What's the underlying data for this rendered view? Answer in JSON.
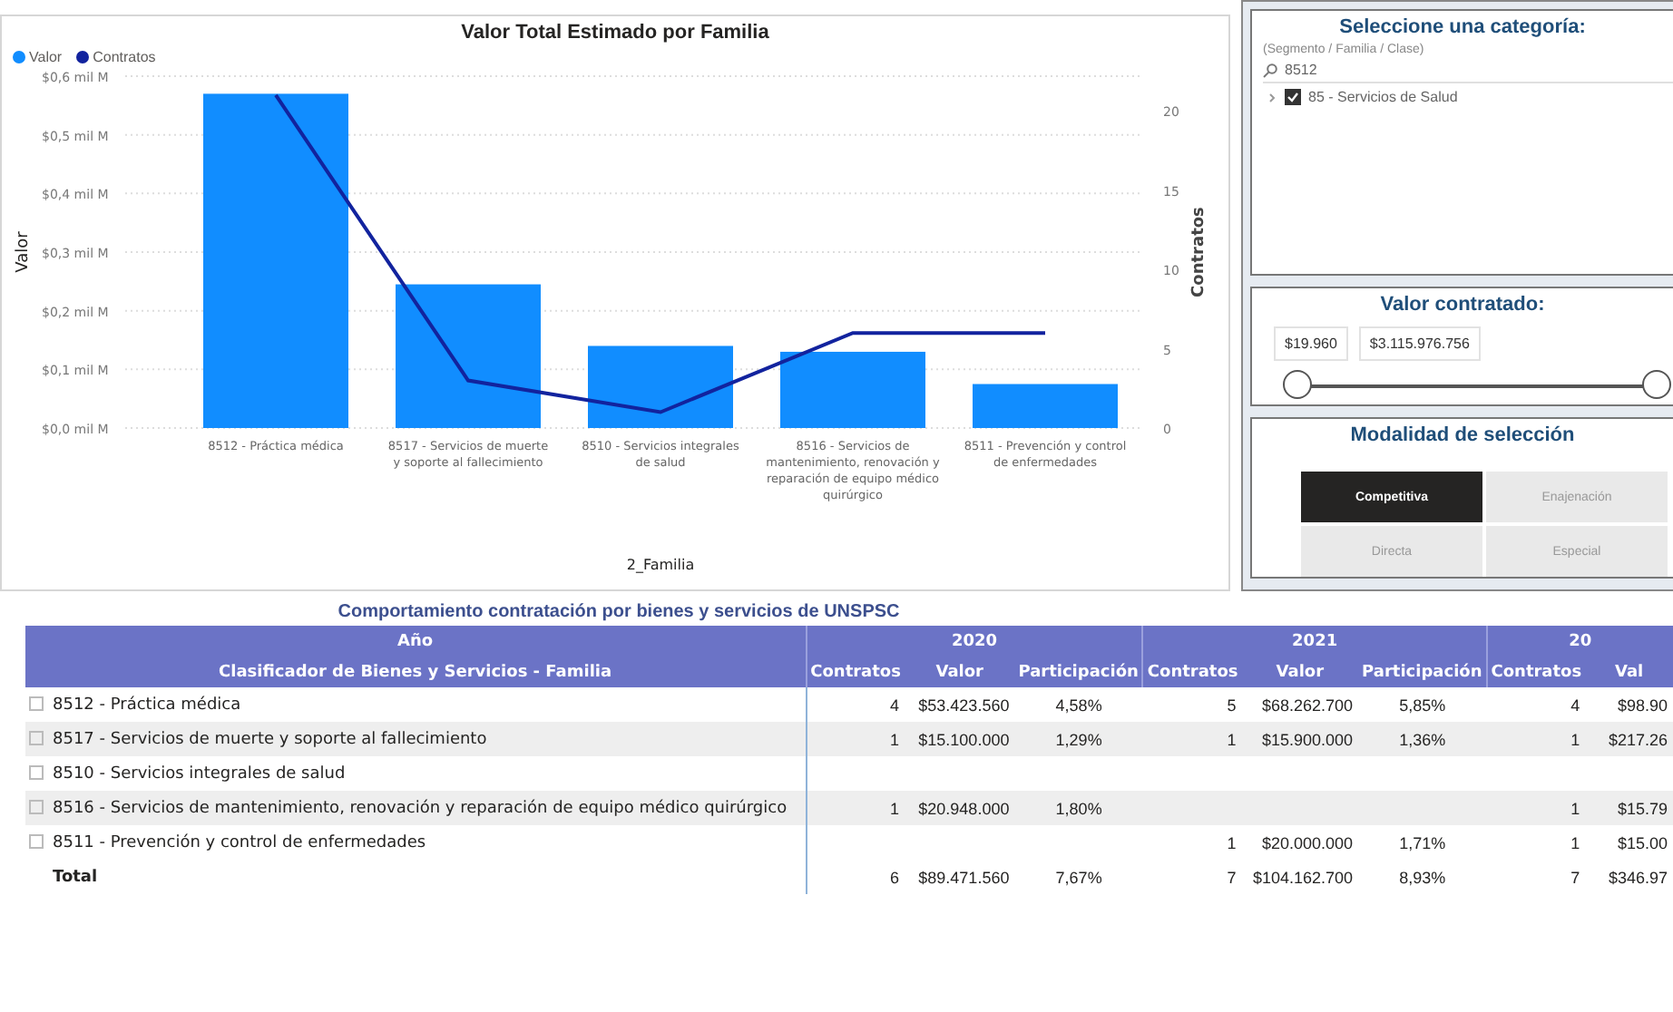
{
  "chart_panel": {
    "chart_data": {
      "type": "bar",
      "title": "Valor Total Estimado por Familia",
      "xlabel": "2_Familia",
      "ylabel": "Valor",
      "y2label": "Contratos",
      "categories": [
        "8512 - Práctica médica",
        "8517 - Servicios de muerte y soporte al fallecimiento",
        "8510 - Servicios integrales de salud",
        "8516 - Servicios de mantenimiento, renovación y reparación de equipo médico quirúrgico",
        "8511 - Prevención y control de enfermedades"
      ],
      "series": [
        {
          "name": "Valor",
          "color": "#118dff",
          "values": [
            0.57,
            0.245,
            0.14,
            0.13,
            0.075
          ]
        },
        {
          "name": "Contratos",
          "type": "line",
          "axis": "y2",
          "color": "#12239e",
          "values": [
            21,
            3,
            1,
            6,
            6
          ]
        }
      ],
      "grid": true,
      "legend": "top-left",
      "ylim": [
        0,
        0.6
      ],
      "y2lim": [
        0,
        22.2
      ],
      "yticks": [
        {
          "value": 0,
          "label": "$0,0 mil M"
        },
        {
          "value": 0.1,
          "label": "$0,1 mil M"
        },
        {
          "value": 0.2,
          "label": "$0,2 mil M"
        },
        {
          "value": 0.3,
          "label": "$0,3 mil M"
        },
        {
          "value": 0.4,
          "label": "$0,4 mil M"
        },
        {
          "value": 0.5,
          "label": "$0,5 mil M"
        },
        {
          "value": 0.6,
          "label": "$0,6 mil M"
        }
      ],
      "y2ticks": [
        0,
        5,
        10,
        15,
        20
      ]
    }
  },
  "category_slicer": {
    "title": "Seleccione una categoría:",
    "subtitle": "(Segmento / Familia / Clase)",
    "search": {
      "value": "8512"
    },
    "items": [
      {
        "label": "85 - Servicios de Salud",
        "checked": true,
        "expanded": false
      }
    ]
  },
  "value_slicer": {
    "title": "Valor contratado:",
    "min_value": "$19.960",
    "max_value": "$3.115.976.756",
    "low": {
      "level": 0
    },
    "high": {
      "level": 1
    }
  },
  "modality": {
    "title": "Modalidad de selección",
    "options": [
      {
        "label": "Competitiva",
        "selected": true
      },
      {
        "label": "Enajenación",
        "selected": false
      },
      {
        "label": "Directa",
        "selected": false
      },
      {
        "label": "Especial",
        "selected": false
      }
    ]
  },
  "table": {
    "title": "Comportamiento contratación por bienes y servicios de UNSPSC",
    "year_label": "Año",
    "row_header": "Clasificador de Bienes y Servicios - Familia",
    "years": [
      {
        "year": "2020",
        "columns": [
          "Contratos",
          "Valor",
          "Participación"
        ]
      },
      {
        "year": "2021",
        "columns": [
          "Contratos",
          "Valor",
          "Participación"
        ]
      },
      {
        "year": "20",
        "columns": [
          "Contratos",
          "Val"
        ]
      }
    ],
    "rows": [
      {
        "label": "8512 - Práctica médica",
        "cells": [
          "4",
          "$53.423.560",
          "4,58%",
          "5",
          "$68.262.700",
          "5,85%",
          "4",
          "$98.90"
        ]
      },
      {
        "label": "8517 - Servicios de muerte y soporte al fallecimiento",
        "cells": [
          "1",
          "$15.100.000",
          "1,29%",
          "1",
          "$15.900.000",
          "1,36%",
          "1",
          "$217.26"
        ]
      },
      {
        "label": "8510 - Servicios integrales de salud",
        "cells": [
          "",
          "",
          "",
          "",
          "",
          "",
          "",
          ""
        ]
      },
      {
        "label": "8516 - Servicios de mantenimiento, renovación y reparación de equipo médico quirúrgico",
        "cells": [
          "1",
          "$20.948.000",
          "1,80%",
          "",
          "",
          "",
          "1",
          "$15.79"
        ]
      },
      {
        "label": "8511 - Prevención y control de enfermedades",
        "cells": [
          "",
          "",
          "",
          "1",
          "$20.000.000",
          "1,71%",
          "1",
          "$15.00"
        ]
      }
    ],
    "total": {
      "label": "Total",
      "cells": [
        "6",
        "$89.471.560",
        "7,67%",
        "7",
        "$104.162.700",
        "8,93%",
        "7",
        "$346.97"
      ]
    }
  }
}
